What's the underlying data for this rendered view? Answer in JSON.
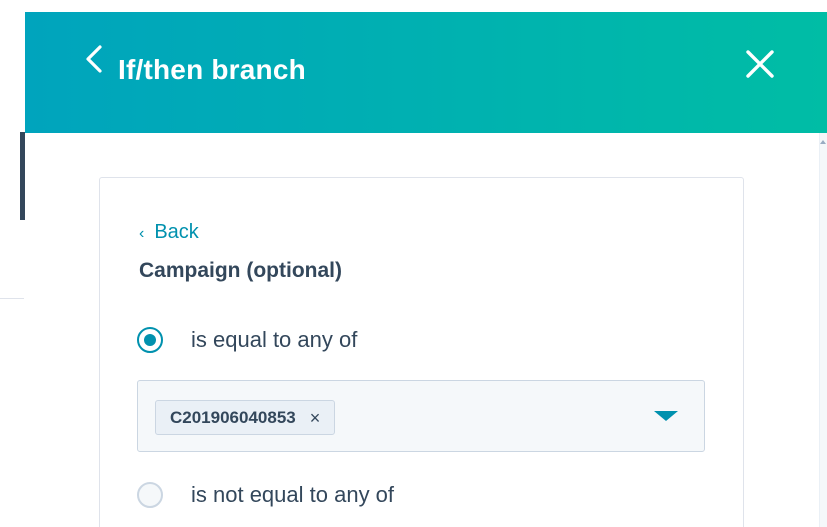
{
  "header": {
    "title": "If/then branch",
    "back_icon": "chevron-left-icon",
    "close_icon": "close-icon"
  },
  "filter": {
    "back_label": "Back",
    "back_caret": "‹",
    "label": "Campaign (optional)",
    "options": [
      {
        "label": "is equal to any of",
        "selected": true
      },
      {
        "label": "is not equal to any of",
        "selected": false
      }
    ],
    "selected_values": [
      {
        "text": "C201906040853",
        "remove_glyph": "×"
      }
    ]
  },
  "colors": {
    "header_gradient_start": "#00a4bd",
    "header_gradient_end": "#00bda5",
    "accent": "#0091ae",
    "text": "#33475b",
    "border": "#cbd6e2"
  }
}
